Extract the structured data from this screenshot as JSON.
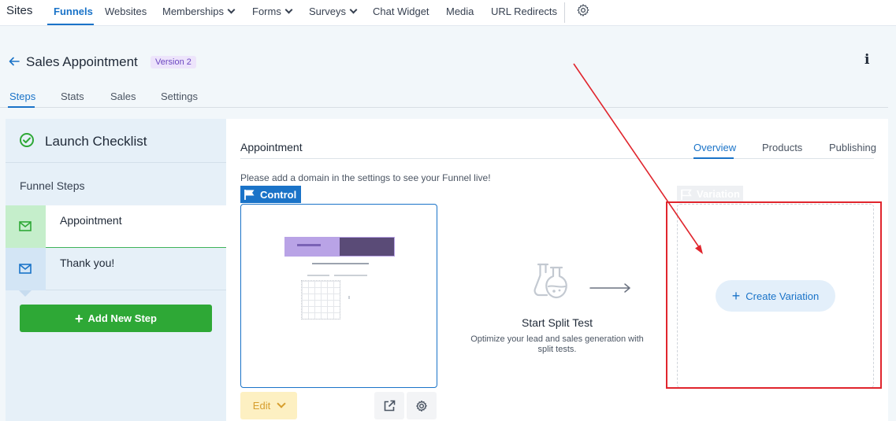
{
  "topnav": {
    "brand": "Sites",
    "items": [
      {
        "label": "Funnels",
        "active": true
      },
      {
        "label": "Websites"
      },
      {
        "label": "Memberships",
        "dropdown": true
      },
      {
        "label": "Forms",
        "dropdown": true
      },
      {
        "label": "Surveys",
        "dropdown": true
      },
      {
        "label": "Chat Widget"
      },
      {
        "label": "Media"
      },
      {
        "label": "URL Redirects"
      }
    ],
    "settings_icon": "gear-icon"
  },
  "header": {
    "title": "Sales Appointment",
    "version": "Version 2",
    "info_icon": "i"
  },
  "subtabs": [
    {
      "label": "Steps",
      "active": true
    },
    {
      "label": "Stats"
    },
    {
      "label": "Sales"
    },
    {
      "label": "Settings"
    }
  ],
  "sidebar": {
    "checklist_label": "Launch Checklist",
    "funnel_steps_label": "Funnel Steps",
    "steps": [
      {
        "label": "Appointment",
        "active": true
      },
      {
        "label": "Thank you!"
      }
    ],
    "add_step_label": "Add New Step"
  },
  "main": {
    "title": "Appointment",
    "tabs": [
      {
        "label": "Overview",
        "active": true
      },
      {
        "label": "Products"
      },
      {
        "label": "Publishing"
      }
    ],
    "domain_note": "Please add a domain in the settings to see your Funnel live!",
    "control_label": "Control",
    "variation_label": "Variation",
    "edit_label": "Edit",
    "split_test": {
      "title": "Start Split Test",
      "description": "Optimize your lead and sales generation with split tests."
    },
    "create_variation_label": "Create Variation"
  },
  "colors": {
    "accent": "#1a73c8",
    "success": "#2ea836",
    "annotation": "#e0252d",
    "edit_bg": "#fdf0c2"
  }
}
